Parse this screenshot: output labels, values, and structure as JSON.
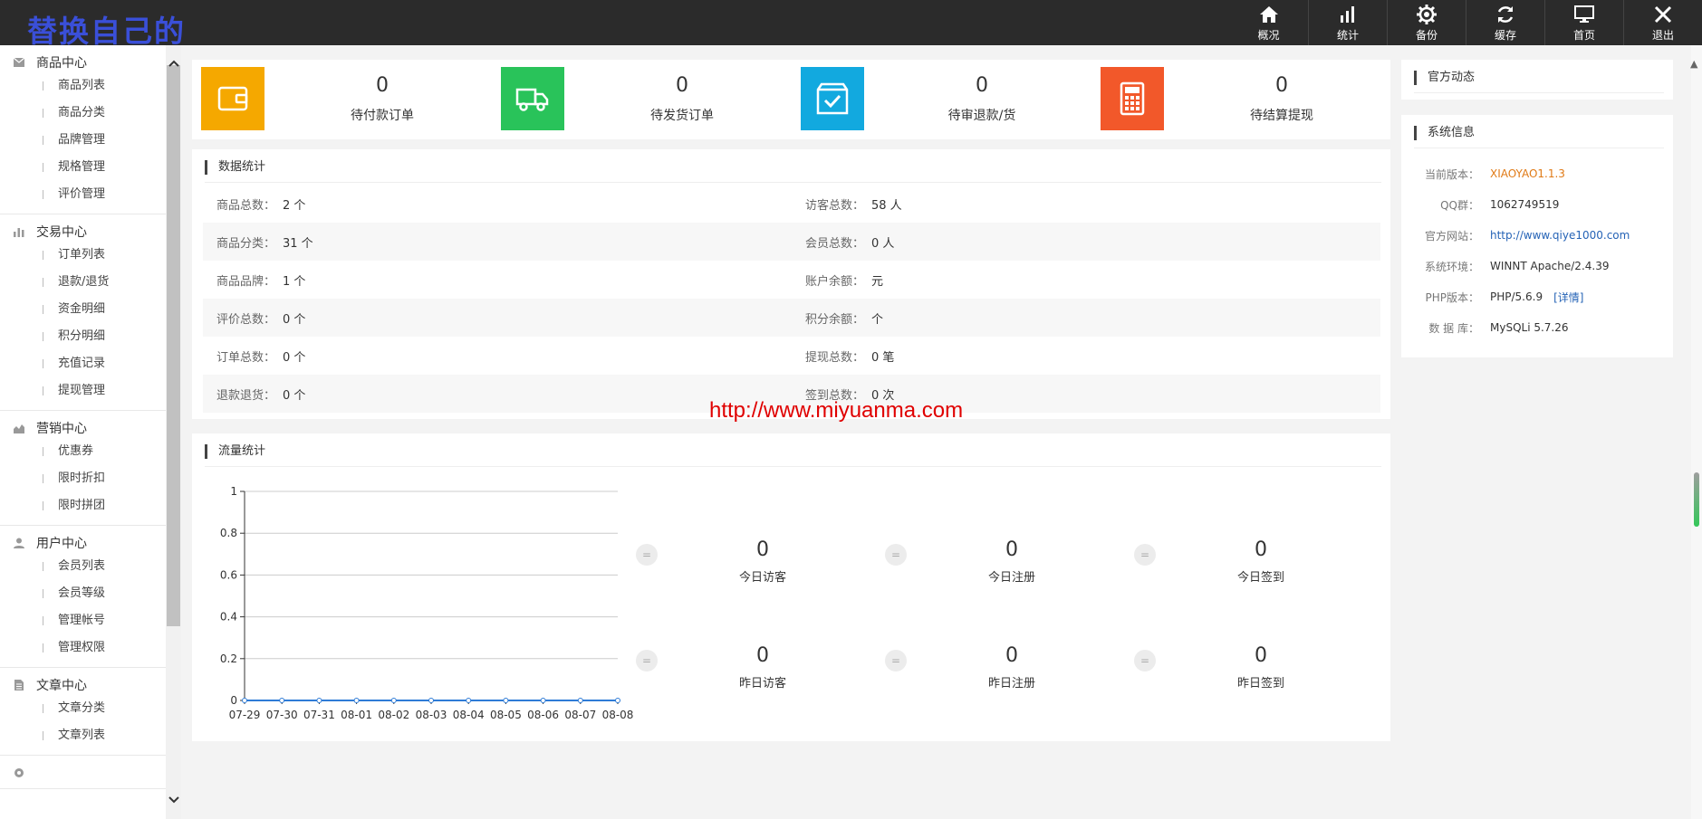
{
  "app": {
    "logo_text": "替换自己的"
  },
  "topnav": [
    {
      "label": "概况",
      "icon": "home-icon"
    },
    {
      "label": "统计",
      "icon": "bar-chart-icon"
    },
    {
      "label": "备份",
      "icon": "gear-icon"
    },
    {
      "label": "缓存",
      "icon": "refresh-icon"
    },
    {
      "label": "首页",
      "icon": "monitor-icon"
    },
    {
      "label": "退出",
      "icon": "close-icon"
    }
  ],
  "sidebar": {
    "groups": [
      {
        "title": "商品中心",
        "icon": "mail-icon",
        "items": [
          "商品列表",
          "商品分类",
          "品牌管理",
          "规格管理",
          "评价管理"
        ]
      },
      {
        "title": "交易中心",
        "icon": "bar-chart-icon",
        "items": [
          "订单列表",
          "退款/退货",
          "资金明细",
          "积分明细",
          "充值记录",
          "提现管理"
        ]
      },
      {
        "title": "营销中心",
        "icon": "area-chart-icon",
        "items": [
          "优惠券",
          "限时折扣",
          "限时拼团"
        ]
      },
      {
        "title": "用户中心",
        "icon": "user-icon",
        "items": [
          "会员列表",
          "会员等级",
          "管理帐号",
          "管理权限"
        ]
      },
      {
        "title": "文章中心",
        "icon": "document-icon",
        "items": [
          "文章分类",
          "文章列表"
        ]
      },
      {
        "title": "",
        "icon": "settings-icon",
        "items": []
      }
    ]
  },
  "stats": [
    {
      "value": "0",
      "label": "待付款订单",
      "color": "#f5a800",
      "icon": "wallet-icon"
    },
    {
      "value": "0",
      "label": "待发货订单",
      "color": "#29c35a",
      "icon": "truck-icon"
    },
    {
      "value": "0",
      "label": "待审退款/货",
      "color": "#12a9df",
      "icon": "checkbox-icon"
    },
    {
      "value": "0",
      "label": "待结算提现",
      "color": "#f2582a",
      "icon": "calculator-icon"
    }
  ],
  "data_stats": {
    "title": "数据统计",
    "rows": [
      [
        {
          "k": "商品总数：",
          "v": "2 个"
        },
        {
          "k": "访客总数：",
          "v": "58 人"
        }
      ],
      [
        {
          "k": "商品分类：",
          "v": "31 个"
        },
        {
          "k": "会员总数：",
          "v": "0 人"
        }
      ],
      [
        {
          "k": "商品品牌：",
          "v": "1 个"
        },
        {
          "k": "账户余额：",
          "v": "元"
        }
      ],
      [
        {
          "k": "评价总数：",
          "v": "0 个"
        },
        {
          "k": "积分余额：",
          "v": "个"
        }
      ],
      [
        {
          "k": "订单总数：",
          "v": "0 个"
        },
        {
          "k": "提现总数：",
          "v": "0 笔"
        }
      ],
      [
        {
          "k": "退款退货：",
          "v": "0 个"
        },
        {
          "k": "签到总数：",
          "v": "0 次"
        }
      ]
    ]
  },
  "traffic": {
    "title": "流量统计",
    "metrics": [
      {
        "value": "0",
        "label": "今日访客"
      },
      {
        "value": "0",
        "label": "今日注册"
      },
      {
        "value": "0",
        "label": "今日签到"
      },
      {
        "value": "0",
        "label": "昨日访客"
      },
      {
        "value": "0",
        "label": "昨日注册"
      },
      {
        "value": "0",
        "label": "昨日签到"
      }
    ],
    "metric_dot": "="
  },
  "chart_data": {
    "type": "line",
    "categories": [
      "07-29",
      "07-30",
      "07-31",
      "08-01",
      "08-02",
      "08-03",
      "08-04",
      "08-05",
      "08-06",
      "08-07",
      "08-08"
    ],
    "values": [
      0,
      0,
      0,
      0,
      0,
      0,
      0,
      0,
      0,
      0,
      0
    ],
    "yticks": [
      "0",
      "0.2",
      "0.4",
      "0.6",
      "0.8",
      "1"
    ],
    "ylim": [
      0,
      1
    ],
    "grid": true,
    "line_color": "#2e7bd6"
  },
  "watermark": "http://www.miyuanma.com",
  "news": {
    "title": "官方动态"
  },
  "system": {
    "title": "系统信息",
    "rows": [
      {
        "k": "当前版本：",
        "v": "XIAOYAO1.1.3",
        "style": "orange"
      },
      {
        "k": "QQ群：",
        "v": "1062749519",
        "style": ""
      },
      {
        "k": "官方网站：",
        "v": "http://www.qiye1000.com",
        "style": "link"
      },
      {
        "k": "系统环境：",
        "v": "WINNT Apache/2.4.39",
        "style": ""
      },
      {
        "k": "PHP版本：",
        "v": "PHP/5.6.9",
        "style": "",
        "detail": "[详情]"
      },
      {
        "k": "数 据 库：",
        "v": "MySQLi 5.7.26",
        "style": ""
      }
    ]
  }
}
